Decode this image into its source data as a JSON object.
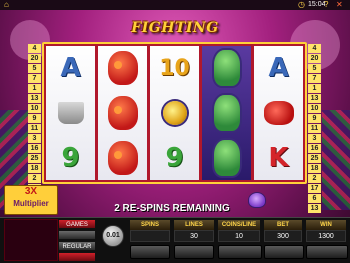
{
  "topbar": {
    "home_icon": "home-icon",
    "clock_icon": "clock-icon",
    "clock": "15:04",
    "help_icon": "help-icon",
    "close_icon": "close-icon"
  },
  "logo": {
    "text": "FIGHTING FISH"
  },
  "paylines": {
    "left": [
      "4",
      "20",
      "5",
      "7",
      "1",
      "13",
      "10",
      "9",
      "11",
      "3",
      "16",
      "25",
      "18",
      "2",
      "17",
      "6",
      "13"
    ],
    "right": [
      "4",
      "20",
      "5",
      "7",
      "1",
      "13",
      "10",
      "9",
      "11",
      "3",
      "16",
      "25",
      "18",
      "2",
      "17",
      "6",
      "13"
    ]
  },
  "reels": [
    [
      "A",
      "ice-bucket",
      "9"
    ],
    [
      "red-boxer-fish",
      "red-boxer-fish",
      "red-boxer-fish"
    ],
    [
      "10",
      "gold-medal",
      "9"
    ],
    [
      "wild-green-fish",
      "wild-green-fish",
      "wild-green-fish"
    ],
    [
      "A",
      "boxing-gloves",
      "K"
    ]
  ],
  "multiplier": {
    "value": "3X",
    "label": "Multiplier"
  },
  "banner": {
    "text": "2 RE-SPINS REMAINING"
  },
  "console": {
    "side_buttons": [
      "GAMES",
      "",
      "REGULAR",
      ""
    ],
    "coin_value": "0.01",
    "stats": [
      {
        "label": "SPINS",
        "value": ""
      },
      {
        "label": "LINES",
        "value": "30"
      },
      {
        "label": "COINS/LINE",
        "value": "10"
      },
      {
        "label": "BET",
        "value": "300"
      },
      {
        "label": "WIN",
        "value": "1300"
      }
    ]
  },
  "colors": {
    "accent": "#ffd23a",
    "background": "#a2207e",
    "reel_frame": "#b0182c"
  }
}
